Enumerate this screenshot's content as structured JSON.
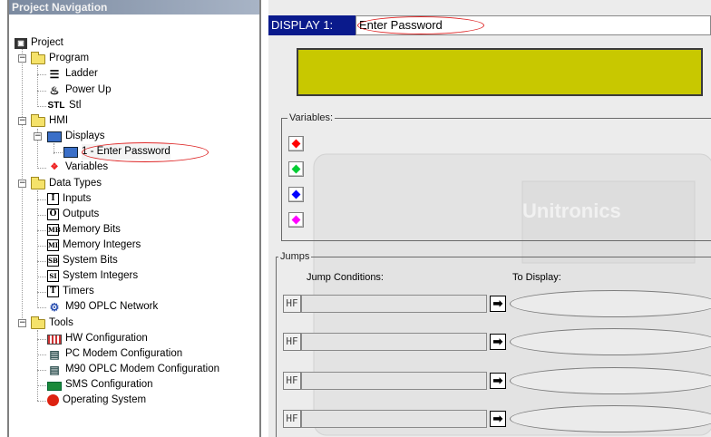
{
  "nav": {
    "title": "Project Navigation",
    "items": [
      {
        "label": "Project",
        "icon": "project-icon"
      },
      {
        "label": "Program",
        "icon": "folder-icon"
      },
      {
        "label": "Ladder",
        "icon": "ladder-icon"
      },
      {
        "label": "Power Up",
        "icon": "power-up-icon"
      },
      {
        "label": "Stl",
        "icon": "stl-icon"
      },
      {
        "label": "HMI",
        "icon": "folder-icon"
      },
      {
        "label": "Displays",
        "icon": "displays-icon"
      },
      {
        "label": "1 - Enter Password",
        "icon": "display-icon"
      },
      {
        "label": "Variables",
        "icon": "variables-icon"
      },
      {
        "label": "Data Types",
        "icon": "folder-icon"
      },
      {
        "label": "Inputs",
        "icon": "inputs-icon",
        "glyph": "I"
      },
      {
        "label": "Outputs",
        "icon": "outputs-icon",
        "glyph": "O"
      },
      {
        "label": "Memory Bits",
        "icon": "memory-bits-icon",
        "glyph": "MB"
      },
      {
        "label": "Memory Integers",
        "icon": "memory-integers-icon",
        "glyph": "MI"
      },
      {
        "label": "System Bits",
        "icon": "system-bits-icon",
        "glyph": "SB"
      },
      {
        "label": "System Integers",
        "icon": "system-integers-icon",
        "glyph": "SI"
      },
      {
        "label": "Timers",
        "icon": "timers-icon",
        "glyph": "T"
      },
      {
        "label": "M90 OPLC Network",
        "icon": "network-icon"
      },
      {
        "label": "Tools",
        "icon": "folder-icon"
      },
      {
        "label": "HW Configuration",
        "icon": "hw-config-icon"
      },
      {
        "label": "PC Modem Configuration",
        "icon": "modem-icon"
      },
      {
        "label": "M90 OPLC Modem Configuration",
        "icon": "modem-icon"
      },
      {
        "label": "SMS Configuration",
        "icon": "sms-icon"
      },
      {
        "label": "Operating System",
        "icon": "os-icon"
      }
    ]
  },
  "display": {
    "label": "DISPLAY 1:",
    "name": "Enter Password",
    "lcd_color": "#c8c800"
  },
  "variables": {
    "legend": "Variables:",
    "colors": [
      "#ff0000",
      "#00cc33",
      "#0000ff",
      "#ff00ff"
    ]
  },
  "jumps": {
    "legend": "Jumps",
    "conditions_header": "Jump Conditions:",
    "to_display_header": "To Display:",
    "condition_glyph": "HF",
    "arrow": "➡"
  },
  "brand": "Unitronics"
}
